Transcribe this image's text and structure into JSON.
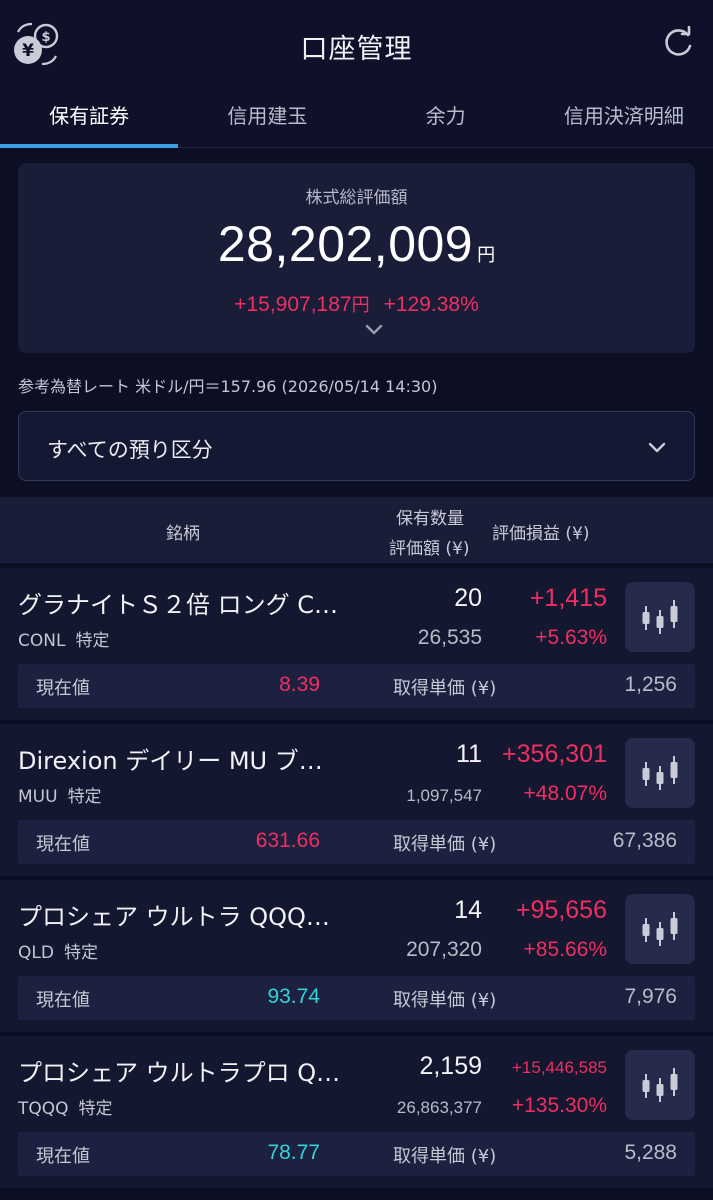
{
  "header": {
    "title": "口座管理",
    "left_icon": "yen-dollar-exchange-icon",
    "right_icon": "refresh-icon"
  },
  "tabs": [
    {
      "label": "保有証券",
      "active": true
    },
    {
      "label": "信用建玉",
      "active": false
    },
    {
      "label": "余力",
      "active": false
    },
    {
      "label": "信用決済明細",
      "active": false
    }
  ],
  "summary": {
    "label": "株式総評価額",
    "total": "28,202,009",
    "total_unit": "円",
    "pl_amount": "+15,907,187",
    "pl_unit": "円",
    "pl_percent": "+129.38%"
  },
  "fx_rate": "参考為替レート 米ドル/円＝157.96 (2026/05/14 14:30)",
  "account_filter": {
    "selected": "すべての預り区分"
  },
  "table_header": {
    "name": "銘柄",
    "qty": "保有数量",
    "value": "評価額 (¥)",
    "pl": "評価損益 (¥)"
  },
  "current_label": "現在値",
  "cost_label": "取得単価 (¥)",
  "holdings": [
    {
      "name": "グラナイトＳ２倍 ロング C…",
      "code": "CONL",
      "account": "特定",
      "qty": "20",
      "value": "26,535",
      "pl": "+1,415",
      "pl_percent": "+5.63%",
      "current": "8.39",
      "cost": "1,256"
    },
    {
      "name": "Direxion デイリー MU ブ…",
      "code": "MUU",
      "account": "特定",
      "qty": "11",
      "value": "1,097,547",
      "pl": "+356,301",
      "pl_percent": "+48.07%",
      "current": "631.66",
      "cost": "67,386"
    },
    {
      "name": "プロシェア ウルトラ QQQ…",
      "code": "QLD",
      "account": "特定",
      "qty": "14",
      "value": "207,320",
      "pl": "+95,656",
      "pl_percent": "+85.66%",
      "current": "93.74",
      "cost": "7,976"
    },
    {
      "name": "プロシェア ウルトラプロ Q…",
      "code": "TQQQ",
      "account": "特定",
      "qty": "2,159",
      "value": "26,863,377",
      "pl": "+15,446,585",
      "pl_percent": "+135.30%",
      "current": "78.77",
      "cost": "5,288"
    }
  ],
  "colors": {
    "gain": "#ef2f62",
    "current_up": "#ef2f62",
    "current_down": "#33d4d8",
    "accent": "#3aa0e6"
  }
}
